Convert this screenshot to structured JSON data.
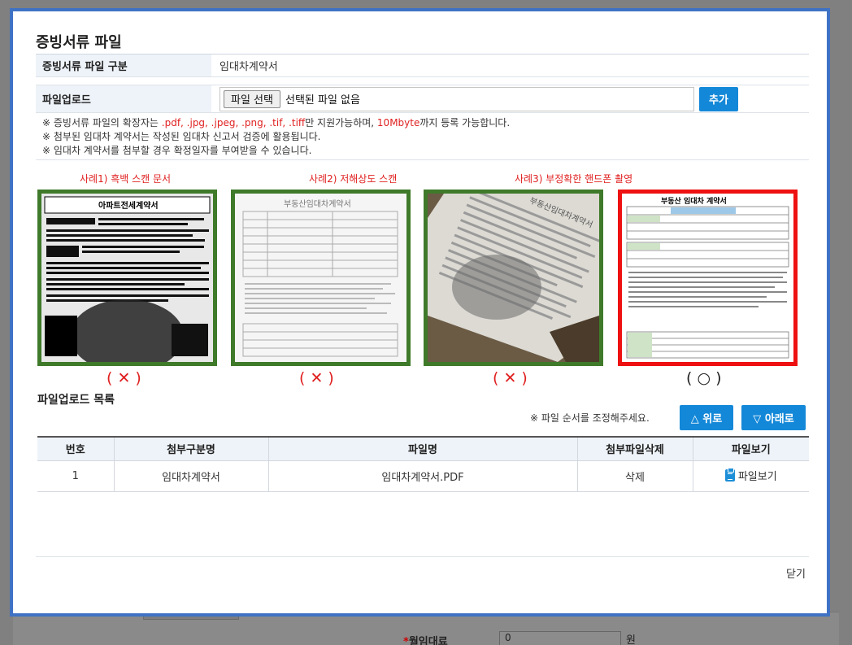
{
  "background": {
    "field_label": "월임대료",
    "required_mark": "*",
    "field_value": "0",
    "field_unit": "원"
  },
  "modal": {
    "title": "증빙서류 파일",
    "form": {
      "category_label": "증빙서류 파일 구분",
      "category_value": "임대차계약서",
      "upload_label": "파일업로드",
      "file_button": "파일 선택",
      "file_status": "선택된 파일 없음",
      "add_button": "추가",
      "notes": {
        "line1_prefix": "※ 증빙서류 파일의 확장자는 ",
        "line1_ext": ".pdf, .jpg, .jpeg, .png, .tif, .tiff",
        "line1_mid": "만 지원가능하며, ",
        "line1_size": "10Mbyte",
        "line1_suffix": "까지 등록 가능합니다.",
        "line2": "※ 첨부된 임대차 계약서는 작성된 임대차 신고서 검증에 활용됩니다.",
        "line3": "※ 임대차 계약서를 첨부할 경우 확정일자를 부여받을 수 있습니다."
      }
    },
    "examples": [
      {
        "caption": "사례1) 흑백 스캔 문서",
        "mark": "( ✕ )",
        "valid": false
      },
      {
        "caption": "사례2) 저해상도 스캔",
        "mark": "( ✕ )",
        "valid": false
      },
      {
        "caption": "사례3) 부정확한 핸드폰 촬영",
        "mark": "( ✕ )",
        "valid": false
      },
      {
        "caption": "",
        "mark": "( ○ )",
        "valid": true
      }
    ],
    "example_doc_titles": {
      "ex1": "아파트전세계약서",
      "ex2": "부동산임대차계약서",
      "ex3": "부동산임대차계약서",
      "ex4": "부동산 임대차 계약서"
    },
    "upload_list": {
      "title": "파일업로드 목록",
      "order_note": "※ 파일 순서를 조정해주세요.",
      "up_button": "△ 위로",
      "down_button": "▽ 아래로",
      "columns": [
        "번호",
        "첨부구분명",
        "파일명",
        "첨부파일삭제",
        "파일보기"
      ],
      "rows": [
        {
          "no": "1",
          "category": "임대차계약서",
          "filename": "임대차계약서.PDF",
          "delete": "삭제",
          "view": "파일보기"
        }
      ]
    },
    "close_label": "닫기"
  }
}
